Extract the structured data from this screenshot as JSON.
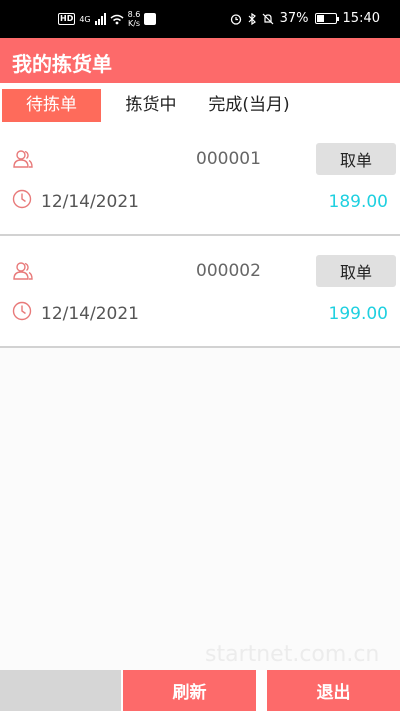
{
  "status_bar": {
    "network_badge": "HD",
    "network_type": "4G",
    "speed": "8.6",
    "speed_unit": "K/s",
    "battery": "37%",
    "time": "15:40"
  },
  "header": {
    "title": "我的拣货单"
  },
  "tabs": [
    {
      "label": "待拣单",
      "active": true
    },
    {
      "label": "拣货中",
      "active": false
    },
    {
      "label": "完成(当月)",
      "active": false
    }
  ],
  "orders": [
    {
      "number": "000001",
      "date": "12/14/2021",
      "amount": "189.00",
      "button": "取单"
    },
    {
      "number": "000002",
      "date": "12/14/2021",
      "amount": "199.00",
      "button": "取单"
    }
  ],
  "footer": {
    "refresh_label": "刷新",
    "exit_label": "退出"
  },
  "watermark": "startnet.com.cn",
  "colors": {
    "accent": "#fd6a6a",
    "tab_active": "#fe6b5b",
    "amount": "#1fd0e0"
  }
}
